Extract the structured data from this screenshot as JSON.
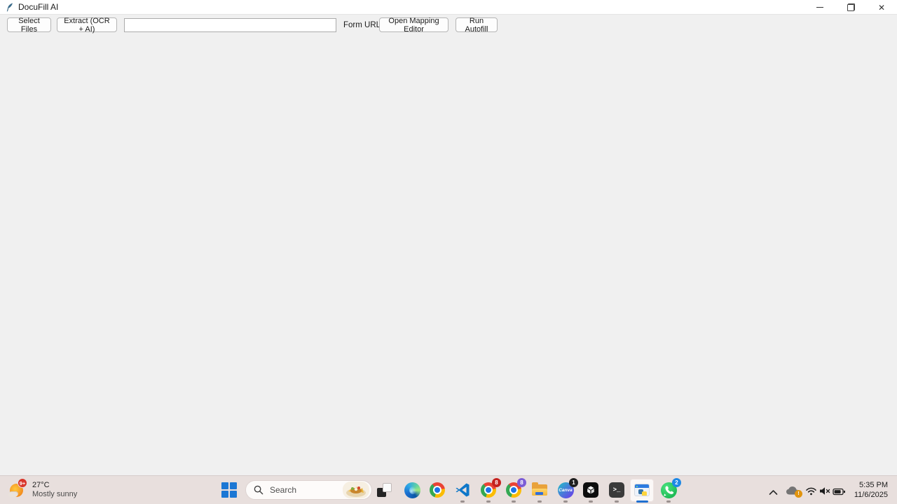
{
  "window": {
    "title": "DocuFill AI",
    "controls": {
      "minimize_glyph": "",
      "close_glyph": "✕"
    }
  },
  "toolbar": {
    "select_files_label": "Select Files",
    "extract_label": "Extract (OCR + AI)",
    "form_url_value": "",
    "form_url_label": "Form URL",
    "open_mapping_editor_label": "Open Mapping Editor",
    "run_autofill_label": "Run Autofill"
  },
  "taskbar": {
    "weather": {
      "badge": "9+",
      "temperature": "27°C",
      "condition": "Mostly sunny"
    },
    "search": {
      "placeholder": "Search"
    },
    "icons": {
      "terminal_glyph": ">_",
      "canva_label": "Canva"
    },
    "badges": {
      "chrome_profile_1": "8",
      "chrome_profile_2": "8",
      "canva": "1",
      "whatsapp": "2"
    },
    "tray": {
      "time": "5:35 PM",
      "date": "11/6/2025"
    }
  },
  "colors": {
    "accent": "#1f6fd0",
    "taskbar_bg": "#e8dfdd",
    "app_bg": "#f0f0f0",
    "titlebar_bg": "#ffffff"
  }
}
